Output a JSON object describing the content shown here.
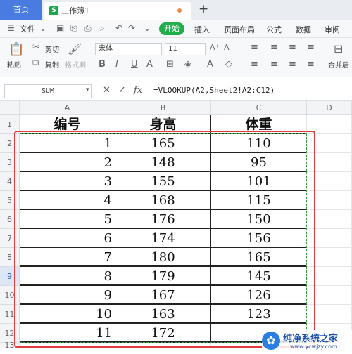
{
  "titlebar": {
    "home_tab": "首页",
    "doc_tab_icon": "S",
    "doc_tab": "工作簿1",
    "new_tab_icon": "+"
  },
  "menubar": {
    "file": "文件",
    "start": "开始",
    "items": [
      "插入",
      "页面布局",
      "公式",
      "数据",
      "审阅"
    ]
  },
  "ribbon": {
    "cut": "剪切",
    "copy": "复制",
    "paste": "粘贴",
    "format_painter": "格式刷",
    "font_name": "宋体",
    "font_size": "11",
    "merge_center": "合并居"
  },
  "formula_bar": {
    "name_box": "SUM",
    "fx": "fx",
    "formula": "=VLOOKUP(A2,Sheet2!A2:C12)"
  },
  "sheet": {
    "columns": [
      "A",
      "B",
      "C",
      "D"
    ],
    "rows": [
      "1",
      "2",
      "3",
      "4",
      "5",
      "6",
      "7",
      "8",
      "9",
      "10",
      "11",
      "12",
      "13"
    ],
    "headers": [
      "编号",
      "身高",
      "体重"
    ],
    "data": [
      [
        "1",
        "165",
        "110"
      ],
      [
        "2",
        "148",
        "95"
      ],
      [
        "3",
        "155",
        "101"
      ],
      [
        "4",
        "168",
        "115"
      ],
      [
        "5",
        "176",
        "150"
      ],
      [
        "6",
        "174",
        "156"
      ],
      [
        "7",
        "180",
        "165"
      ],
      [
        "8",
        "179",
        "145"
      ],
      [
        "9",
        "167",
        "126"
      ],
      [
        "10",
        "163",
        "123"
      ],
      [
        "11",
        "172",
        ""
      ]
    ]
  },
  "watermark": {
    "site": "纯净系统之家",
    "url": "www.ycwjzy.com"
  }
}
